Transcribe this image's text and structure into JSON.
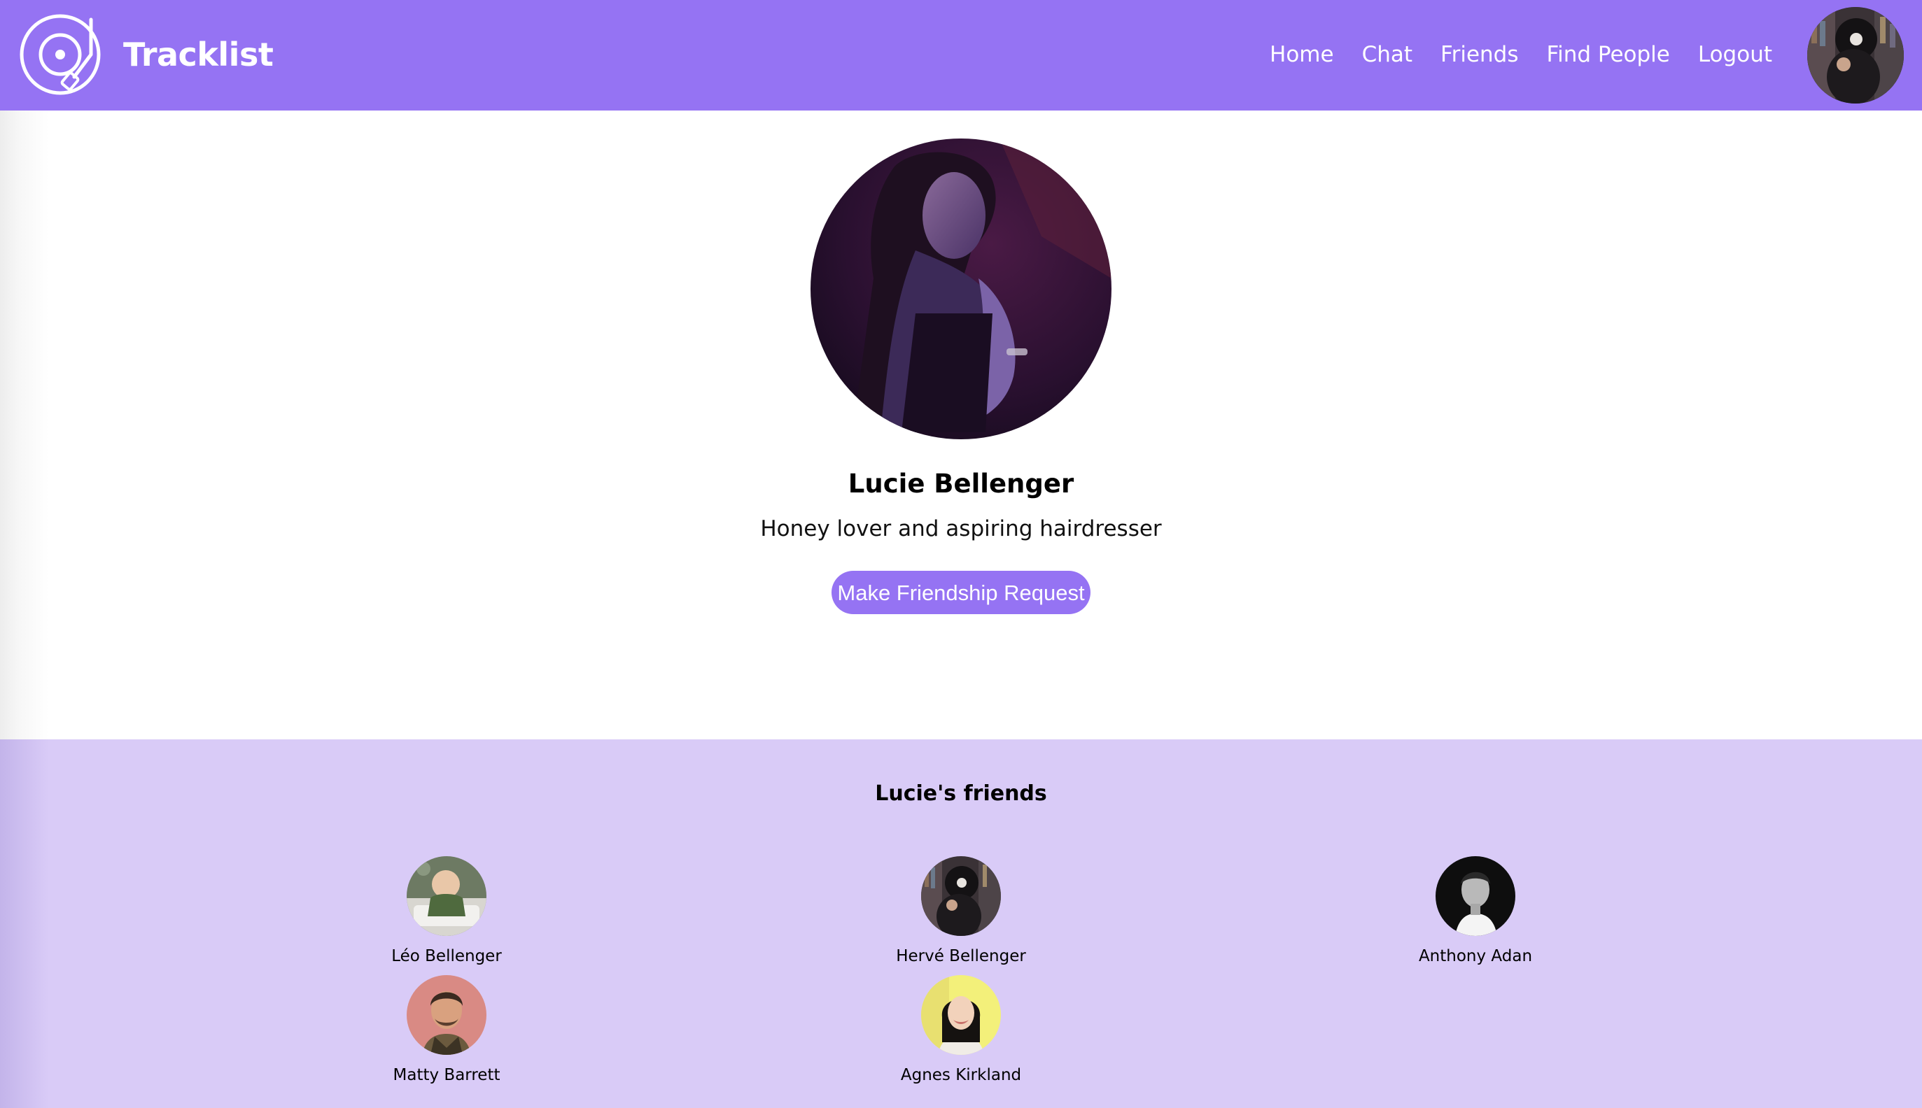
{
  "navbar": {
    "brand": "Tracklist",
    "links": [
      "Home",
      "Chat",
      "Friends",
      "Find People",
      "Logout"
    ],
    "accent_color": "#9573f3"
  },
  "profile": {
    "name": "Lucie Bellenger",
    "bio": "Honey lover and aspiring hairdresser",
    "action_label": "Make Friendship Request"
  },
  "friends": {
    "heading": "Lucie's friends",
    "section_color": "#d9cbf7",
    "list": [
      {
        "name": "Léo Bellenger"
      },
      {
        "name": "Hervé Bellenger"
      },
      {
        "name": "Anthony Adan"
      },
      {
        "name": "Matty Barrett"
      },
      {
        "name": "Agnes Kirkland"
      }
    ]
  },
  "icons": {
    "logo": "turntable-icon"
  }
}
